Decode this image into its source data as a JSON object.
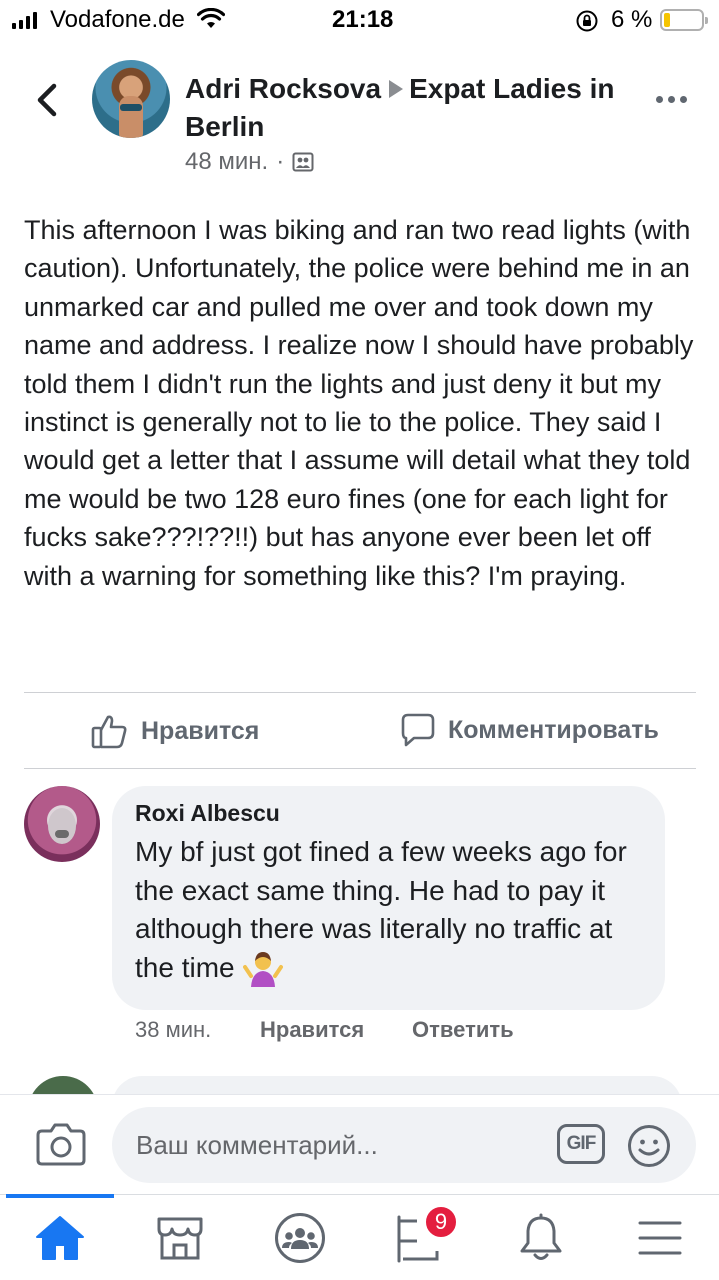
{
  "status_bar": {
    "carrier": "Vodafone.de",
    "time": "21:18",
    "battery_percent": "6 %",
    "battery_level": 0.06,
    "icons": [
      "signal-icon",
      "wifi-icon",
      "orientation-lock-icon",
      "battery-icon"
    ]
  },
  "post": {
    "author": "Adri Rocksova",
    "group": "Expat Ladies in Berlin",
    "time": "48 мин.",
    "separator": "·",
    "audience_icon": "group-audience-icon",
    "text": "This afternoon I was biking and ran two read lights (with caution). Unfortunately, the police were behind me in an unmarked car and pulled me over and took down my name and address. I realize now I should have probably told them I didn't run the lights and just deny it but my instinct is generally not to lie to the police. They said I would get a letter that I assume will detail what they told me would be two 128 euro fines (one for each light for fucks sake???!??!!) but has anyone ever been let off with a warning for something like this? I'm praying.",
    "like_label": "Нравится",
    "comment_label": "Комментировать"
  },
  "comments": [
    {
      "author": "Roxi Albescu",
      "text": "My bf just got fined a few weeks ago for the exact same thing. He had to pay it although there was literally no traffic at the time",
      "emoji": "person-shrugging-emoji",
      "time": "38 мин.",
      "like_label": "Нравится",
      "reply_label": "Ответить"
    }
  ],
  "composer": {
    "placeholder": "Ваш комментарий...",
    "gif_label": "GIF"
  },
  "nav": {
    "items": [
      "home-icon",
      "marketplace-icon",
      "groups-icon",
      "notifications-flag-icon",
      "bell-icon",
      "menu-icon"
    ],
    "badge": "9",
    "active": "home-icon"
  },
  "colors": {
    "accent": "#1877f2",
    "badge": "#e41e3f",
    "bubble": "#f0f2f5",
    "secondary_text": "#65676b"
  }
}
